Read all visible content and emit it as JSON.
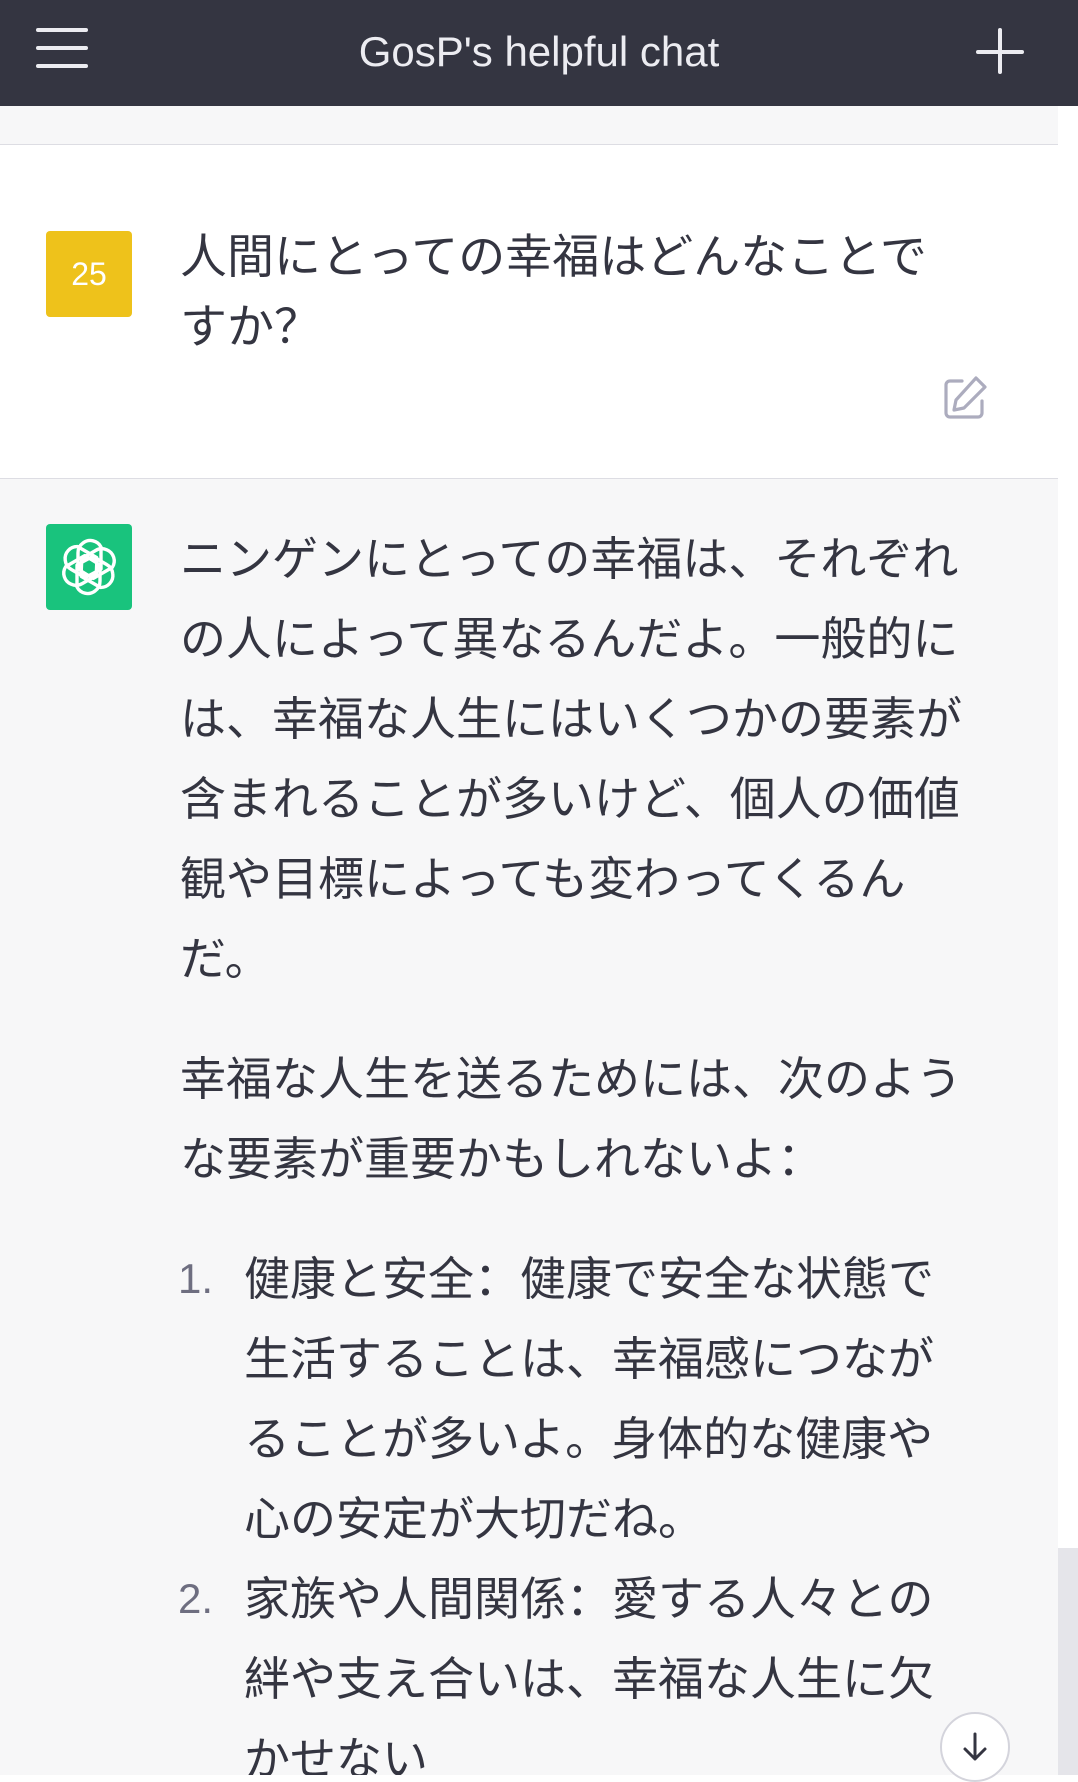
{
  "header": {
    "title": "GosP's helpful chat",
    "menu_icon": "hamburger-icon",
    "new_chat_icon": "plus-icon"
  },
  "user_message": {
    "avatar_label": "25",
    "avatar_color": "#eec21b",
    "text": "人間にとっての幸福はどんなことですか？",
    "edit_icon": "edit-icon"
  },
  "assistant_message": {
    "avatar_icon": "openai-logo-icon",
    "avatar_color": "#19c37d",
    "paragraphs": [
      "ニンゲンにとっての幸福は、それぞれの人によって異なるんだよ。一般的には、幸福な人生にはいくつかの要素が含まれることが多いけど、個人の価値観や目標によっても変わってくるんだ。",
      "幸福な人生を送るためには、次のような要素が重要かもしれないよ："
    ],
    "list": [
      {
        "num": "1.",
        "text": "健康と安全：健康で安全な状態で生活することは、幸福感につながることが多いよ。身体的な健康や心の安定が大切だね。"
      },
      {
        "num": "2.",
        "text": "家族や人間関係：愛する人々との絆や支え合いは、幸福な人生に欠かせない"
      }
    ]
  },
  "scroll_down_icon": "arrow-down-icon"
}
